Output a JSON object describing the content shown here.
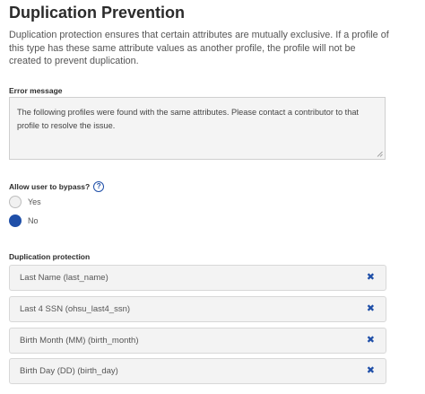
{
  "header": {
    "title": "Duplication Prevention",
    "description": "Duplication protection ensures that certain attributes are mutually exclusive. If a profile of this type has these same attribute values as another profile, the profile will not be created to prevent duplication."
  },
  "error_message": {
    "label": "Error message",
    "value": "The following profiles were found with the same attributes. Please contact a contributor to that profile to resolve the issue."
  },
  "bypass": {
    "label": "Allow user to bypass?",
    "help_icon": "question-circle-icon",
    "options": [
      {
        "label": "Yes",
        "selected": false
      },
      {
        "label": "No",
        "selected": true
      }
    ]
  },
  "duplication_protection": {
    "label": "Duplication protection",
    "remove_icon": "close-icon",
    "items": [
      {
        "label": "Last Name (last_name)"
      },
      {
        "label": "Last 4 SSN (ohsu_last4_ssn)"
      },
      {
        "label": "Birth Month (MM) (birth_month)"
      },
      {
        "label": "Birth Day (DD) (birth_day)"
      }
    ]
  },
  "colors": {
    "accent": "#1f4fa8",
    "field_background": "#f3f3f3",
    "border": "#d8d8d8"
  }
}
